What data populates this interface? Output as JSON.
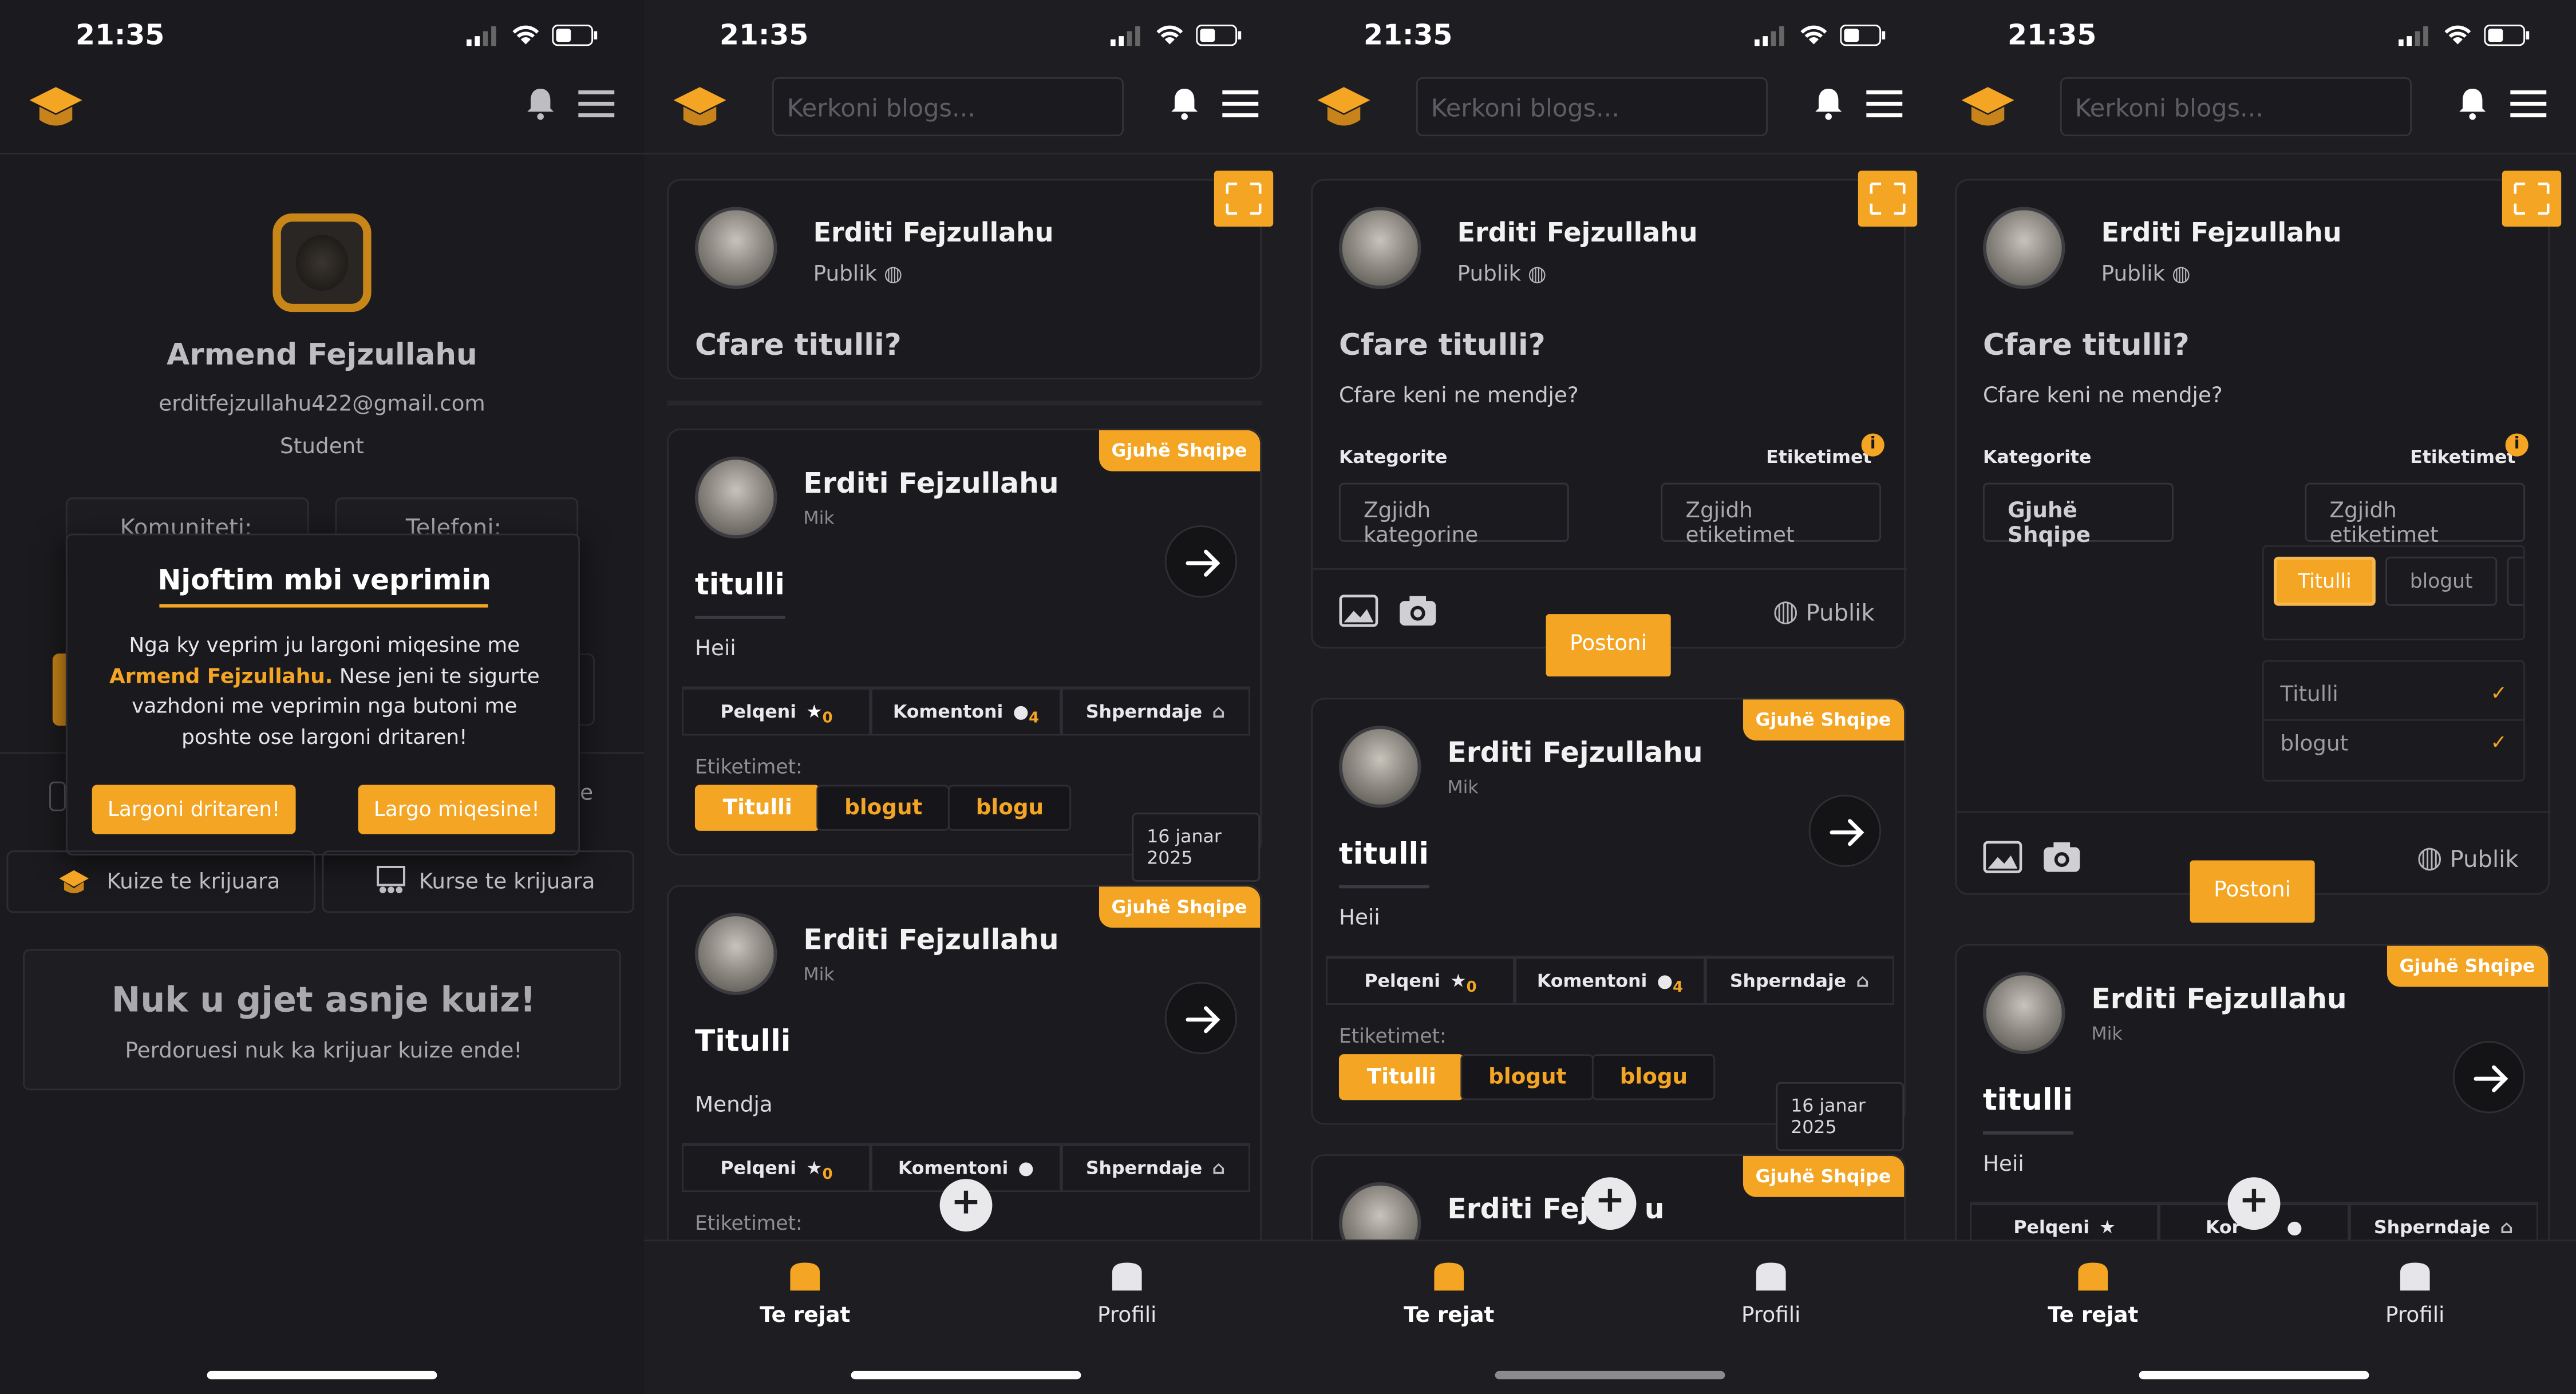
{
  "time": "21:35",
  "accent": "#f5a524",
  "search_placeholder": "Kerkoni blogs...",
  "profile": {
    "name": "Armend Fejzullahu",
    "email": "erditfejzullahu422@gmail.com",
    "role": "Student",
    "stat_left": "Komuniteti:",
    "stat_right": "Telefoni:",
    "dialog": {
      "title": "Njoftim mbi veprimin",
      "text_before": "Nga ky veprim ju largoni miqesine me",
      "highlight": "Armend Fejzullahu.",
      "text_after": "Nese jeni te sigurte vazhdoni me veprimin nga butoni me poshte ose largoni dritaren!",
      "btn_cancel": "Largoni dritaren!",
      "btn_confirm": "Largo miqesine!"
    },
    "stat_right_tail": "e",
    "tab_quizzes": "Kuize te krijuara",
    "tab_courses": "Kurse te krijuara",
    "empty_title": "Nuk u gjet asnje kuiz!",
    "empty_text": "Perdoruesi nuk ka krijuar kuize ende!"
  },
  "composer": {
    "author": "Erditi Fejzullahu",
    "visibility": "Publik",
    "title_placeholder": "Cfare titulli?",
    "body_placeholder": "Cfare keni ne mendje?",
    "category_label": "Kategorite",
    "tags_label": "Etiketimet",
    "info_icon": "i",
    "category_placeholder": "Zgjidh kategorine",
    "category_selected": "Gjuhë Shqipe",
    "tags_placeholder": "Zgjidh etiketimet",
    "post_button": "Postoni",
    "chip_selected": "Titulli",
    "chip_other": "blogut",
    "options": [
      {
        "label": "Titulli",
        "checked": true
      },
      {
        "label": "blogut",
        "checked": true
      }
    ]
  },
  "posts": [
    {
      "author": "Erditi Fejzullahu",
      "role": "Mik",
      "category": "Gjuhë Shqipe",
      "title": "titulli",
      "body": "Heii",
      "likes_label": "Pelqeni",
      "likes_count": "0",
      "comments_label": "Komentoni",
      "comments_count": "4",
      "share_label": "Shperndaje",
      "tags_label": "Etiketimet:",
      "tags": [
        "Titulli",
        "blogut",
        "blogu"
      ],
      "date": "16 janar 2025"
    },
    {
      "author": "Erditi Fejzullahu",
      "role": "Mik",
      "category": "Gjuhë Shqipe",
      "title": "Titulli",
      "body": "Mendja",
      "likes_label": "Pelqeni",
      "likes_count": "0",
      "comments_label": "Komentoni",
      "share_label": "Shperndaje",
      "tags_label": "Etiketimet:"
    }
  ],
  "partial_author": "Erditi Fejz",
  "partial_tail": "u",
  "partial_comment": "Kor",
  "nav": {
    "home": "Te rejat",
    "profile": "Profili"
  },
  "fab": "+"
}
